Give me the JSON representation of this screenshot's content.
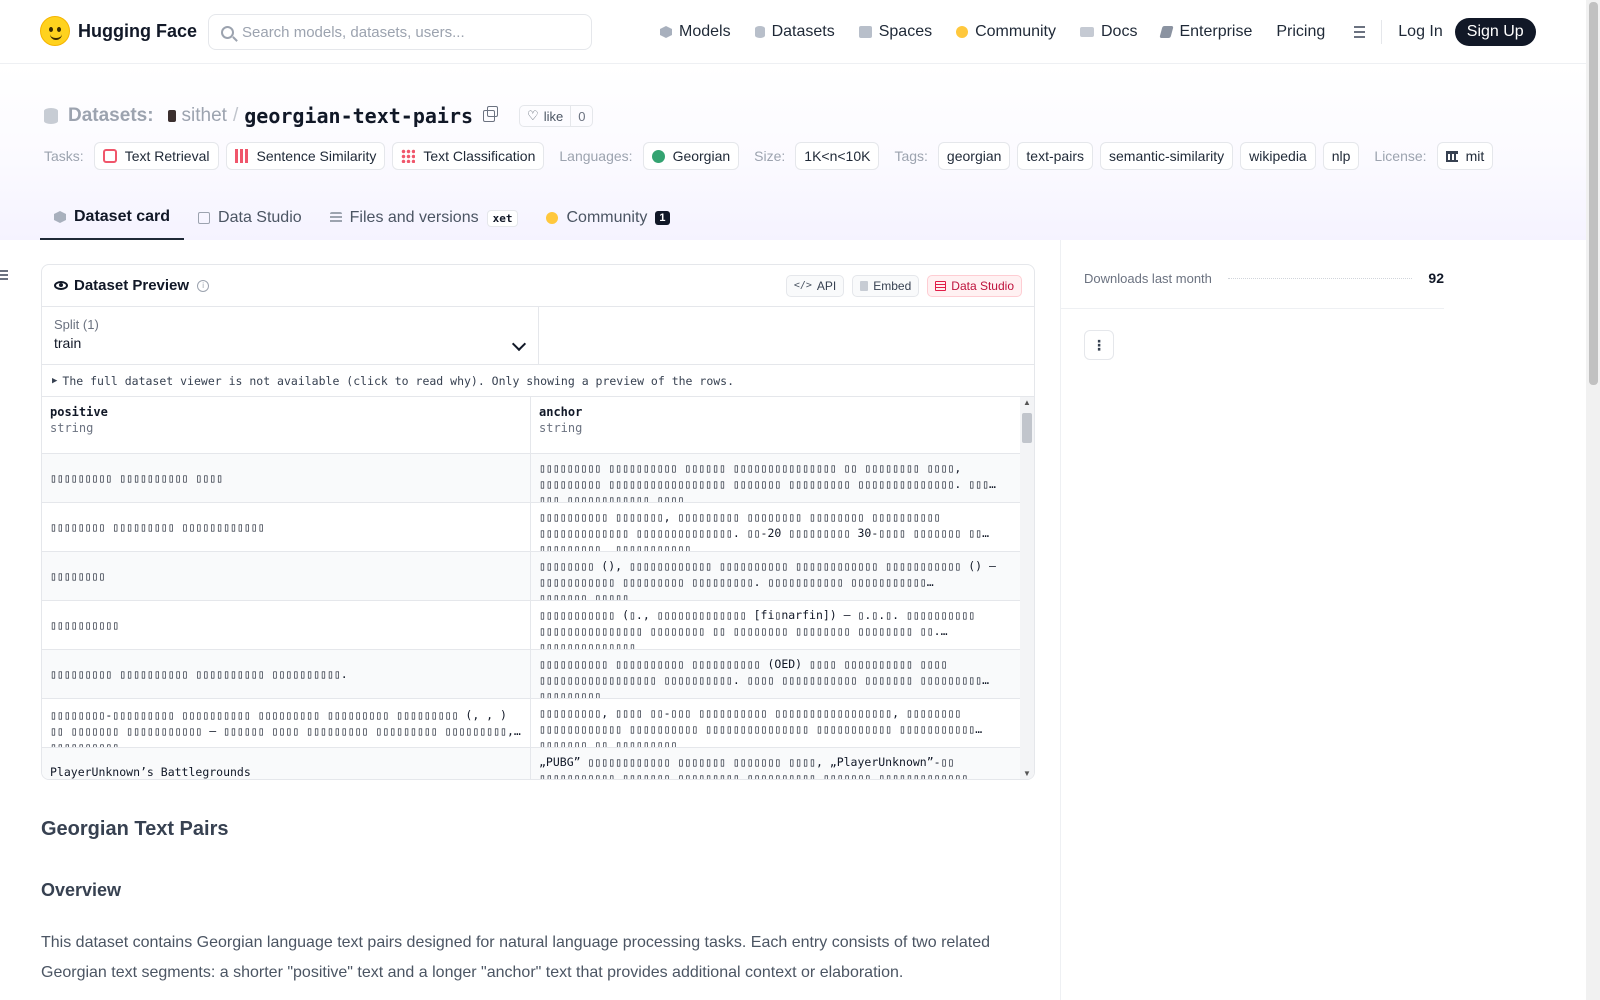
{
  "brand": {
    "name": "Hugging Face"
  },
  "search": {
    "placeholder": "Search models, datasets, users..."
  },
  "nav": {
    "items": [
      {
        "label": "Models",
        "icon": "models-icon"
      },
      {
        "label": "Datasets",
        "icon": "datasets-icon"
      },
      {
        "label": "Spaces",
        "icon": "spaces-icon"
      },
      {
        "label": "Community",
        "icon": "community-icon"
      },
      {
        "label": "Docs",
        "icon": "docs-icon"
      },
      {
        "label": "Enterprise",
        "icon": "enterprise-icon"
      },
      {
        "label": "Pricing"
      }
    ],
    "login": "Log In",
    "signup": "Sign Up"
  },
  "repo": {
    "type_label": "Datasets:",
    "owner": "sithet",
    "separator": "/",
    "name": "georgian-text-pairs",
    "like_label": "like",
    "like_count": "0"
  },
  "tags": {
    "tasks_label": "Tasks:",
    "tasks": [
      "Text Retrieval",
      "Sentence Similarity",
      "Text Classification"
    ],
    "languages_label": "Languages:",
    "language": "Georgian",
    "size_label": "Size:",
    "size": "1K<n<10K",
    "tags_label": "Tags:",
    "tags": [
      "georgian",
      "text-pairs",
      "semantic-similarity",
      "wikipedia",
      "nlp"
    ],
    "license_label": "License:",
    "license": "mit"
  },
  "tabs": {
    "dataset_card": "Dataset card",
    "data_studio": "Data Studio",
    "files": "Files and versions",
    "xet": "xet",
    "community": "Community",
    "community_count": "1"
  },
  "preview": {
    "title": "Dataset Preview",
    "api": "API",
    "embed": "Embed",
    "data_studio": "Data Studio",
    "split_label": "Split (1)",
    "split_value": "train",
    "notice": "The full dataset viewer is not available (click to read why). Only showing a preview of the rows.",
    "columns": [
      {
        "name": "positive",
        "type": "string"
      },
      {
        "name": "anchor",
        "type": "string"
      }
    ],
    "rows": [
      {
        "positive": "▯▯▯▯▯▯▯▯▯ ▯▯▯▯▯▯▯▯▯▯ ▯▯▯▯",
        "anchor": "▯▯▯▯▯▯▯▯▯ ▯▯▯▯▯▯▯▯▯▯ ▯▯▯▯▯▯ ▯▯▯▯▯▯▯▯▯▯▯▯▯▯▯ ▯▯ ▯▯▯▯▯▯▯▯ ▯▯▯▯, ▯▯▯▯▯▯▯▯▯ ▯▯▯▯▯▯▯▯▯▯▯▯▯▯▯▯▯ ▯▯▯▯▯▯▯ ▯▯▯▯▯▯▯▯▯ ▯▯▯▯▯▯▯▯▯▯▯▯▯▯. ▯▯▯ ▯▯▯ ▯▯▯▯▯▯▯▯▯▯▯▯,▯▯▯▯"
      },
      {
        "positive": "▯▯▯▯▯▯▯▯ ▯▯▯▯▯▯▯▯▯ ▯▯▯▯▯▯▯▯▯▯▯▯",
        "anchor": "▯▯▯▯▯▯▯▯▯▯ ▯▯▯▯▯▯▯, ▯▯▯▯▯▯▯▯▯ ▯▯▯▯▯▯▯▯ ▯▯▯▯▯▯▯▯ ▯▯▯▯▯▯▯▯▯▯ ▯▯▯▯▯▯▯▯▯▯▯▯▯ ▯▯▯▯▯▯▯▯▯▯▯▯▯▯. ▯▯-20 ▯▯▯▯▯▯▯▯▯ 30-▯▯▯▯ ▯▯▯▯▯▯▯ ▯▯ ▯▯▯▯▯▯▯▯▯ „▯▯▯▯▯▯▯▯▯▯▯"
      },
      {
        "positive": "▯▯▯▯▯▯▯▯",
        "anchor": "▯▯▯▯▯▯▯▯ (), ▯▯▯▯▯▯▯▯▯▯▯▯ ▯▯▯▯▯▯▯▯▯▯ ▯▯▯▯▯▯▯▯▯▯▯▯ ▯▯▯▯▯▯▯▯▯▯▯ () — ▯▯▯▯▯▯▯▯▯▯▯ ▯▯▯▯▯▯▯▯▯ ▯▯▯▯▯▯▯▯▯. ▯▯▯▯▯▯▯▯▯▯▯ ▯▯▯▯▯▯▯▯▯▯▯ ▯▯▯▯▯▯▯,▯▯▯▯▯"
      },
      {
        "positive": "▯▯▯▯▯▯▯▯▯▯",
        "anchor": "▯▯▯▯▯▯▯▯▯▯▯ (▯., ▯▯▯▯▯▯▯▯▯▯▯▯▯ [fi▯narfin]) — ▯.▯.▯. ▯▯▯▯▯▯▯▯▯▯ ▯▯▯▯▯▯▯▯▯▯▯▯▯▯▯ ▯▯▯▯▯▯▯▯ ▯▯ ▯▯▯▯▯▯▯▯ ▯▯▯▯▯▯▯▯ ▯▯▯▯▯▯▯▯ ▯▯. ▯▯▯▯▯▯▯▯▯▯▯▯▯▯"
      },
      {
        "positive": "▯▯▯▯▯▯▯▯▯ ▯▯▯▯▯▯▯▯▯▯ ▯▯▯▯▯▯▯▯▯▯ ▯▯▯▯▯▯▯▯▯▯.",
        "anchor": "▯▯▯▯▯▯▯▯▯▯ ▯▯▯▯▯▯▯▯▯▯ ▯▯▯▯▯▯▯▯▯▯ (OED) ▯▯▯▯ ▯▯▯▯▯▯▯▯▯▯ ▯▯▯▯ ▯▯▯▯▯▯▯▯▯▯▯▯▯▯▯▯▯ ▯▯▯▯▯▯▯▯▯▯. ▯▯▯▯ ▯▯▯▯▯▯▯▯▯▯▯ ▯▯▯▯▯▯▯ ▯▯▯▯▯▯▯▯▯ ▯▯▯▯▯▯▯▯▯"
      },
      {
        "positive": "▯▯▯▯▯▯▯▯-▯▯▯▯▯▯▯▯▯ ▯▯▯▯▯▯▯▯▯▯ ▯▯▯▯▯▯▯▯▯ ▯▯▯▯▯▯▯▯▯ ▯▯▯▯▯▯▯▯▯ (, , ) ▯▯ ▯▯▯▯▯▯▯ ▯▯▯▯▯▯▯▯▯▯▯ — ▯▯▯▯▯▯ ▯▯▯▯ ▯▯▯▯▯▯▯▯▯ ▯▯▯▯▯▯▯▯▯ ▯▯▯▯▯▯▯▯▯, ▯▯▯▯▯▯▯▯▯▯",
        "anchor": "▯▯▯▯▯▯▯▯▯, ▯▯▯▯ ▯▯-▯▯▯ ▯▯▯▯▯▯▯▯▯▯ ▯▯▯▯▯▯▯▯▯▯▯▯▯▯▯▯▯, ▯▯▯▯▯▯▯▯ ▯▯▯▯▯▯▯▯▯▯▯▯ ▯▯▯▯▯▯▯▯▯▯ ▯▯▯▯▯▯▯▯▯▯▯▯▯▯▯ ▯▯▯▯▯▯▯▯▯▯▯ ▯▯▯▯▯▯▯▯▯▯▯ ▯▯▯▯▯▯▯ ▯▯ ▯▯▯▯▯▯▯▯▯"
      },
      {
        "positive": "PlayerUnknown’s Battlegrounds",
        "anchor": "„PUBG” ▯▯▯▯▯▯▯▯▯▯▯▯ ▯▯▯▯▯▯▯ ▯▯▯▯▯▯▯ ▯▯▯▯, „PlayerUnknown”-▯▯ ▯▯▯▯▯▯▯▯▯▯▯ ▯▯▯▯▯▯▯ ▯▯▯▯▯▯▯▯▯ ▯▯▯▯▯▯▯▯▯▯ ▯▯▯▯▯▯▯ ▯▯▯▯▯▯▯▯▯▯▯▯▯"
      }
    ]
  },
  "card": {
    "title": "Georgian Text Pairs",
    "overview_heading": "Overview",
    "overview_text": "This dataset contains Georgian language text pairs designed for natural language processing tasks. Each entry consists of two related Georgian text segments: a shorter \"positive\" text and a longer \"anchor\" text that provides additional context or elaboration."
  },
  "sidebar": {
    "downloads_label": "Downloads last month",
    "downloads_value": "92",
    "more_label": "⋮"
  }
}
